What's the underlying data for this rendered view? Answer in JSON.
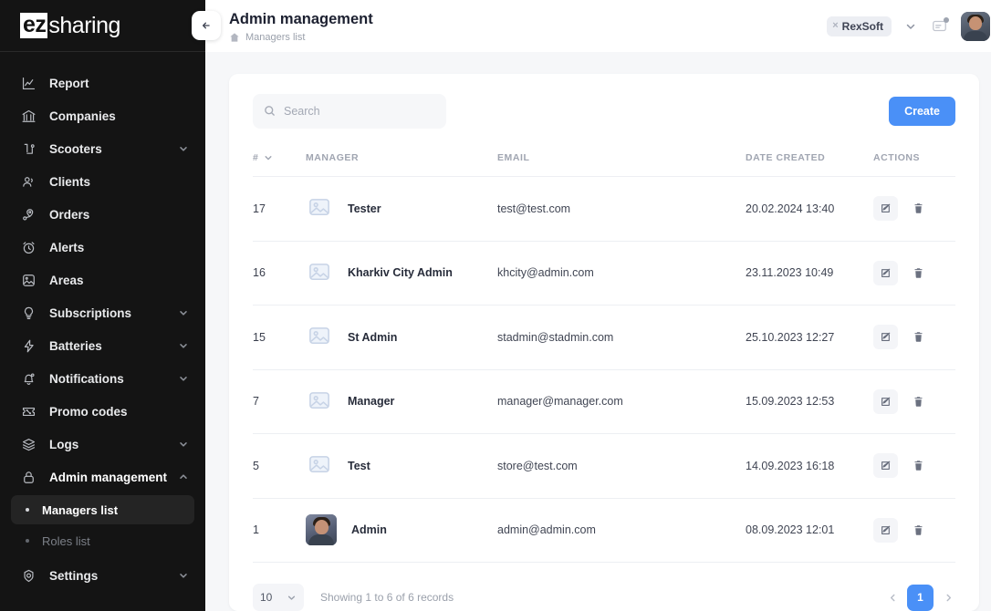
{
  "sidebar": {
    "logo": {
      "bold": "ez",
      "rest": "sharing"
    },
    "collapse_label": "collapse-sidebar",
    "items": [
      {
        "label": "Report",
        "icon": "chart-line-icon",
        "expandable": false
      },
      {
        "label": "Companies",
        "icon": "bank-icon",
        "expandable": false
      },
      {
        "label": "Scooters",
        "icon": "scooter-icon",
        "expandable": true
      },
      {
        "label": "Clients",
        "icon": "users-icon",
        "expandable": false
      },
      {
        "label": "Orders",
        "icon": "location-pin-icon",
        "expandable": false
      },
      {
        "label": "Alerts",
        "icon": "alarm-clock-icon",
        "expandable": false
      },
      {
        "label": "Areas",
        "icon": "map-image-icon",
        "expandable": false
      },
      {
        "label": "Subscriptions",
        "icon": "lightbulb-icon",
        "expandable": true
      },
      {
        "label": "Batteries",
        "icon": "bolt-icon",
        "expandable": true
      },
      {
        "label": "Notifications",
        "icon": "bell-icon",
        "expandable": true
      },
      {
        "label": "Promo codes",
        "icon": "ticket-percent-icon",
        "expandable": false
      },
      {
        "label": "Logs",
        "icon": "layers-icon",
        "expandable": true
      },
      {
        "label": "Admin management",
        "icon": "lock-icon",
        "expandable": true,
        "expanded": true
      },
      {
        "label": "Settings",
        "icon": "gear-icon",
        "expandable": true
      }
    ],
    "sub_items": [
      {
        "label": "Managers list",
        "selected": true
      },
      {
        "label": "Roles list",
        "selected": false
      }
    ]
  },
  "header": {
    "title": "Admin management",
    "breadcrumb": "Managers list",
    "company_chip": "RexSoft",
    "company_chip_remove": "×"
  },
  "toolbar": {
    "search_placeholder": "Search",
    "search_value": "",
    "create_label": "Create"
  },
  "table": {
    "columns": [
      "#",
      "MANAGER",
      "EMAIL",
      "DATE CREATED",
      "ACTIONS"
    ],
    "rows": [
      {
        "num": "17",
        "manager": "Tester",
        "email": "test@test.com",
        "date": "20.02.2024 13:40",
        "has_photo": false
      },
      {
        "num": "16",
        "manager": "Kharkiv City Admin",
        "email": "khcity@admin.com",
        "date": "23.11.2023 10:49",
        "has_photo": false
      },
      {
        "num": "15",
        "manager": "St Admin",
        "email": "stadmin@stadmin.com",
        "date": "25.10.2023 12:27",
        "has_photo": false
      },
      {
        "num": "7",
        "manager": "Manager",
        "email": "manager@manager.com",
        "date": "15.09.2023 12:53",
        "has_photo": false
      },
      {
        "num": "5",
        "manager": "Test",
        "email": "store@test.com",
        "date": "14.09.2023 16:18",
        "has_photo": false
      },
      {
        "num": "1",
        "manager": "Admin",
        "email": "admin@admin.com",
        "date": "08.09.2023 12:01",
        "has_photo": true
      }
    ]
  },
  "pagination": {
    "page_size": "10",
    "info": "Showing 1 to 6 of 6 records",
    "current_page": "1"
  },
  "colors": {
    "accent": "#4a90f7",
    "sidebar_bg": "#141414",
    "page_bg": "#f6f7f9",
    "card_bg": "#ffffff",
    "muted_text": "#9aa0ab"
  }
}
